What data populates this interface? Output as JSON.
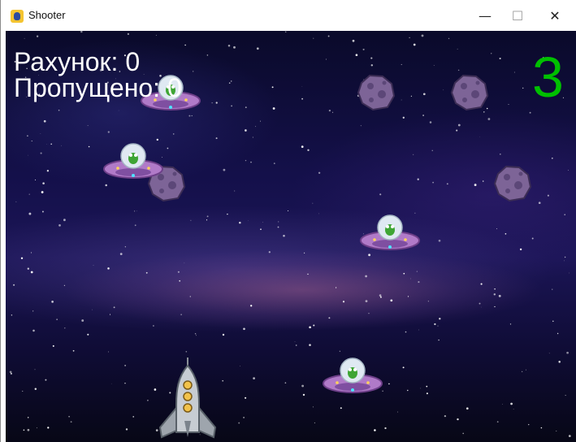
{
  "window": {
    "title": "Shooter",
    "controls": {
      "minimize": "—",
      "maximize": "☐",
      "close": "✕"
    }
  },
  "hud": {
    "score_text": "Рахунок: 0",
    "missed_text": "Пропущено: 0",
    "lives": "3"
  },
  "colors": {
    "lives": "#00c000",
    "hud_text": "#ffffff"
  },
  "sprites": {
    "enemy_icon": "ufo-alien-icon",
    "asteroid_icon": "asteroid-icon",
    "player_icon": "rocket-icon"
  }
}
